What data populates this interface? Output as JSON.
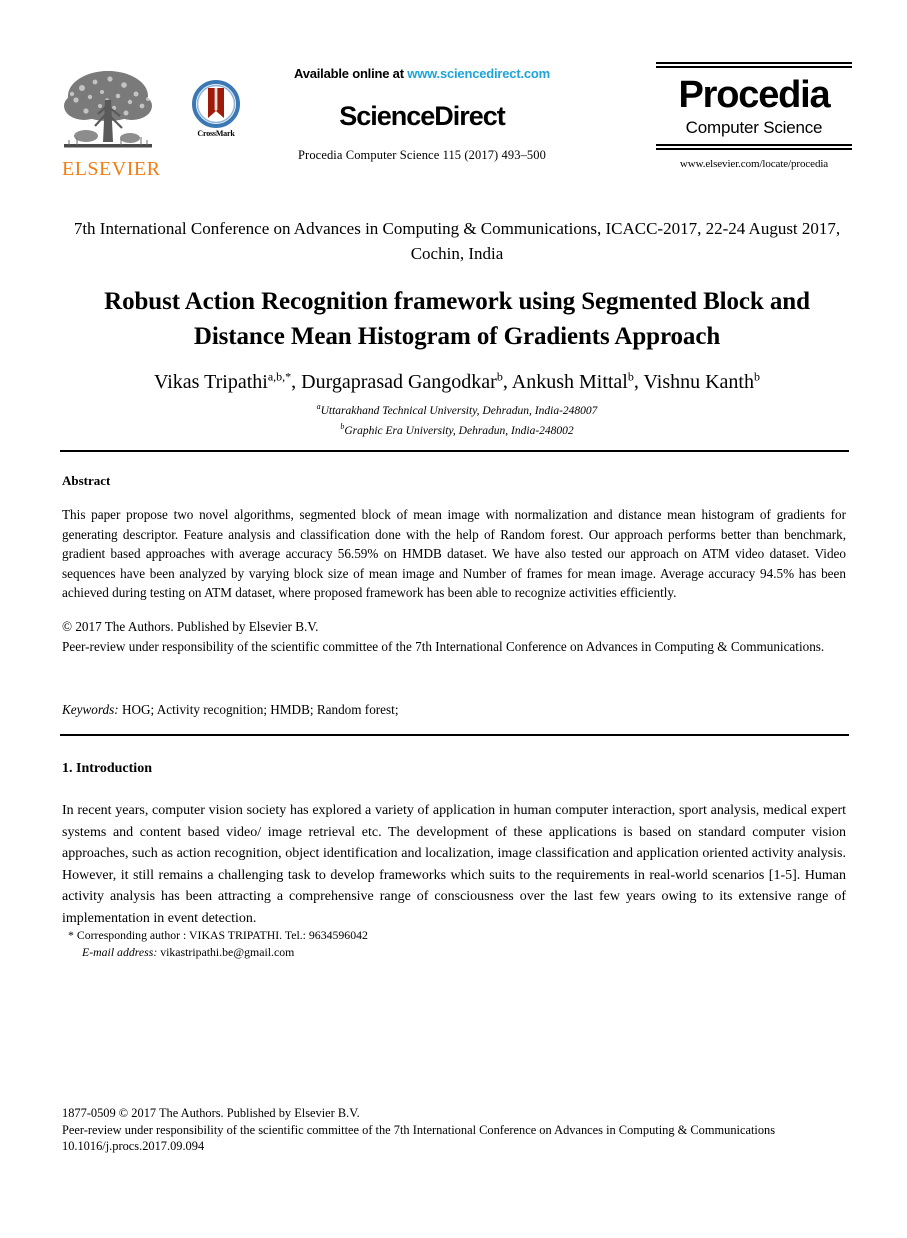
{
  "header": {
    "elsevier_wordmark": "ELSEVIER",
    "crossmark_label": "CrossMark",
    "available_prefix": "Available online at",
    "available_url": "www.sciencedirect.com",
    "sciencedirect_wordmark": "ScienceDirect",
    "citation_line": "Procedia Computer Science 115 (2017) 493–500",
    "procedia_title": "Procedia",
    "procedia_subtitle": "Computer Science",
    "procedia_url": "www.elsevier.com/locate/procedia",
    "colors": {
      "elsevier_orange": "#F07F13",
      "link_blue": "#1FA3D8",
      "crossmark_ring": "#2B6CB0",
      "crossmark_ribbon": "#9E1B0B"
    }
  },
  "conference": "7th International Conference on Advances in Computing & Communications, ICACC-2017, 22-24 August 2017, Cochin, India",
  "title": "Robust Action Recognition framework using Segmented Block and Distance Mean Histogram of Gradients Approach",
  "authors": [
    {
      "name": "Vikas Tripathi",
      "sup": "a,b,*"
    },
    {
      "name": "Durgaprasad Gangodkar",
      "sup": "b"
    },
    {
      "name": "Ankush Mittal",
      "sup": "b"
    },
    {
      "name": "Vishnu Kanth",
      "sup": "b"
    }
  ],
  "affiliations": [
    {
      "sup": "a",
      "text": "Uttarakhand Technical University, Dehradun, India-248007"
    },
    {
      "sup": "b",
      "text": "Graphic Era University, Dehradun, India-248002"
    }
  ],
  "abstract": {
    "heading": "Abstract",
    "body": "This paper propose two novel algorithms, segmented block of mean image with normalization and distance mean histogram of gradients for generating descriptor. Feature analysis and classification done with the help of Random forest. Our approach performs better than benchmark, gradient based approaches with average accuracy 56.59% on HMDB dataset. We have also tested our approach on ATM video dataset. Video sequences have been analyzed by varying block size of mean image and Number of frames for mean image. Average accuracy 94.5% has been achieved during testing on ATM dataset, where proposed framework has been able to recognize activities efficiently.",
    "copyright": "© 2017 The Authors. Published by Elsevier B.V.",
    "peer_review": "Peer-review under responsibility of the scientific committee of the 7th International Conference on Advances in Computing & Communications.",
    "keywords_label": "Keywords:",
    "keywords_value": "HOG; Activity recognition; HMDB; Random forest;"
  },
  "introduction": {
    "heading": "1. Introduction",
    "body": "In recent years, computer vision society has explored a variety of application in human computer interaction, sport analysis, medical expert systems and content based video/ image retrieval etc. The development of these applications is based on standard computer vision approaches, such as action recognition, object identification and localization, image classification and application oriented activity analysis. However, it still remains a challenging task to develop frameworks which suits to the requirements in real-world scenarios [1-5]. Human activity analysis has been attracting a comprehensive range of consciousness over the last few years owing to its extensive range of implementation in event detection."
  },
  "footnote": {
    "corresponding": "* Corresponding author : VIKAS TRIPATHI. Tel.: 9634596042",
    "email_label": "E-mail address:",
    "email_value": "vikastripathi.be@gmail.com"
  },
  "page_footer": {
    "issn_line": "1877-0509 © 2017 The Authors. Published by Elsevier B.V.",
    "peer_review_line": "Peer-review under responsibility of the scientific committee of the 7th International Conference on Advances in Computing & Communications",
    "doi": "10.1016/j.procs.2017.09.094"
  }
}
